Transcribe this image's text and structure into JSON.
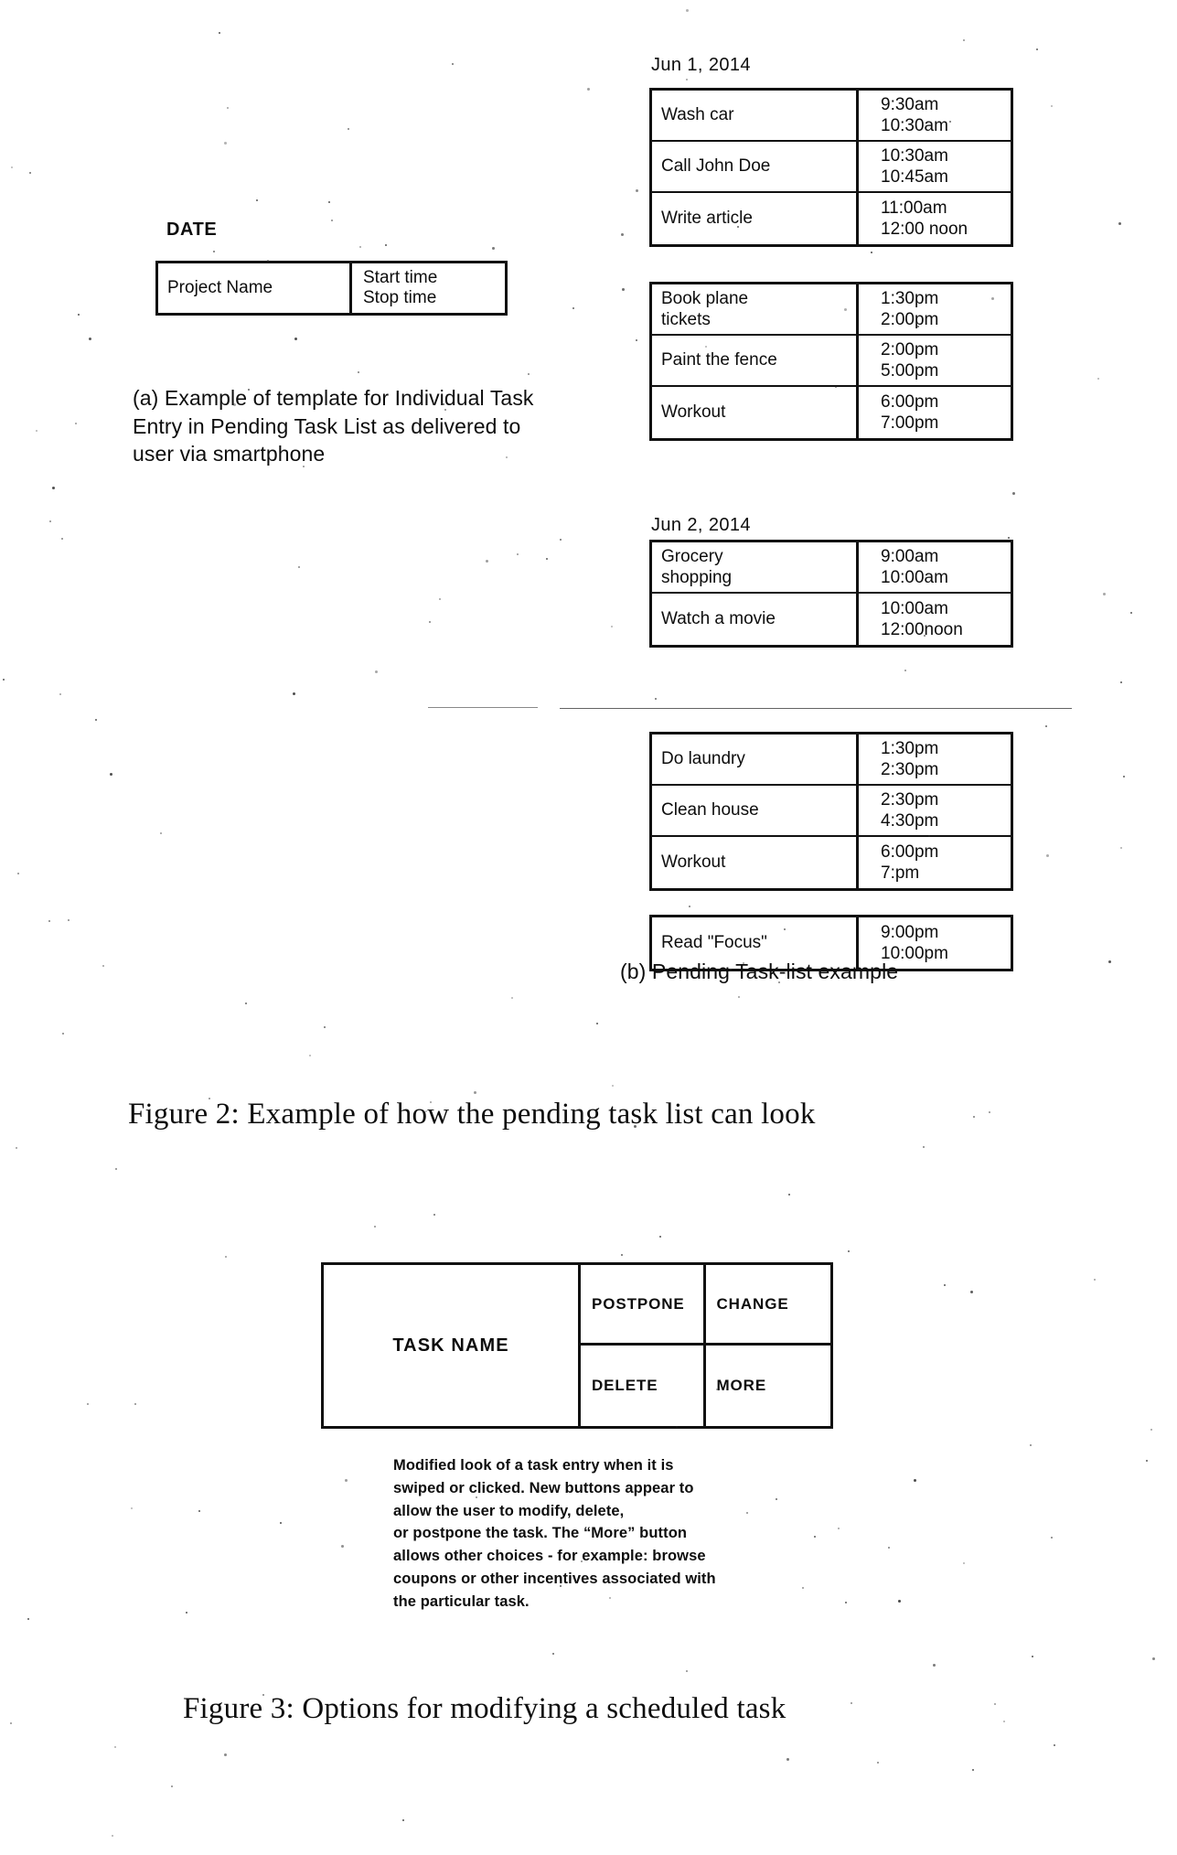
{
  "figure2": {
    "template": {
      "date_label": "DATE",
      "project_name": "Project Name",
      "start_time": "Start time",
      "stop_time": "Stop time"
    },
    "caption_a": "(a) Example of template for Individual Task Entry in Pending Task List as delivered to user via smartphone",
    "caption_b": "(b) Pending Task-list example",
    "days": [
      {
        "label": "Jun 1, 2014",
        "groups": [
          {
            "rows": [
              {
                "task": "Wash car",
                "start": "9:30am",
                "stop": "10:30am"
              },
              {
                "task": "Call John Doe",
                "start": "10:30am",
                "stop": "10:45am"
              },
              {
                "task": "Write article",
                "start": "11:00am",
                "stop": "12:00 noon"
              }
            ]
          },
          {
            "rows": [
              {
                "task": "Book plane tickets",
                "start": "1:30pm",
                "stop": "2:00pm"
              },
              {
                "task": "Paint the fence",
                "start": "2:00pm",
                "stop": "5:00pm"
              },
              {
                "task": "Workout",
                "start": "6:00pm",
                "stop": "7:00pm"
              }
            ]
          }
        ]
      },
      {
        "label": "Jun 2, 2014",
        "groups": [
          {
            "rows": [
              {
                "task": "Grocery shopping",
                "start": "9:00am",
                "stop": "10:00am"
              },
              {
                "task": "Watch a movie",
                "start": "10:00am",
                "stop": "12:00noon"
              }
            ]
          },
          {
            "rows": [
              {
                "task": "Do laundry",
                "start": "1:30pm",
                "stop": "2:30pm"
              },
              {
                "task": "Clean house",
                "start": "2:30pm",
                "stop": "4:30pm"
              },
              {
                "task": "Workout",
                "start": "6:00pm",
                "stop": "7:pm"
              }
            ]
          },
          {
            "rows": [
              {
                "task": "Read \"Focus\"",
                "start": "9:00pm",
                "stop": "10:00pm"
              }
            ]
          }
        ]
      }
    ],
    "figure_caption": "Figure 2:  Example of how the pending task list can look"
  },
  "figure3": {
    "task_name_label": "TASK NAME",
    "buttons": [
      "POSTPONE",
      "CHANGE",
      "DELETE",
      "MORE"
    ],
    "note_lines": [
      "Modified look of a task entry when it is",
      "swiped or clicked. New buttons appear to",
      "allow the user to modify, delete,",
      "or postpone the task. The “More” button",
      "allows other choices - for example: browse",
      "coupons or other incentives associated with",
      "the particular task."
    ],
    "figure_caption": "Figure 3:  Options for modifying a scheduled task"
  },
  "colors": {
    "ink": "#0d0d0d",
    "page": "#ffffff",
    "rule": "#111111"
  }
}
